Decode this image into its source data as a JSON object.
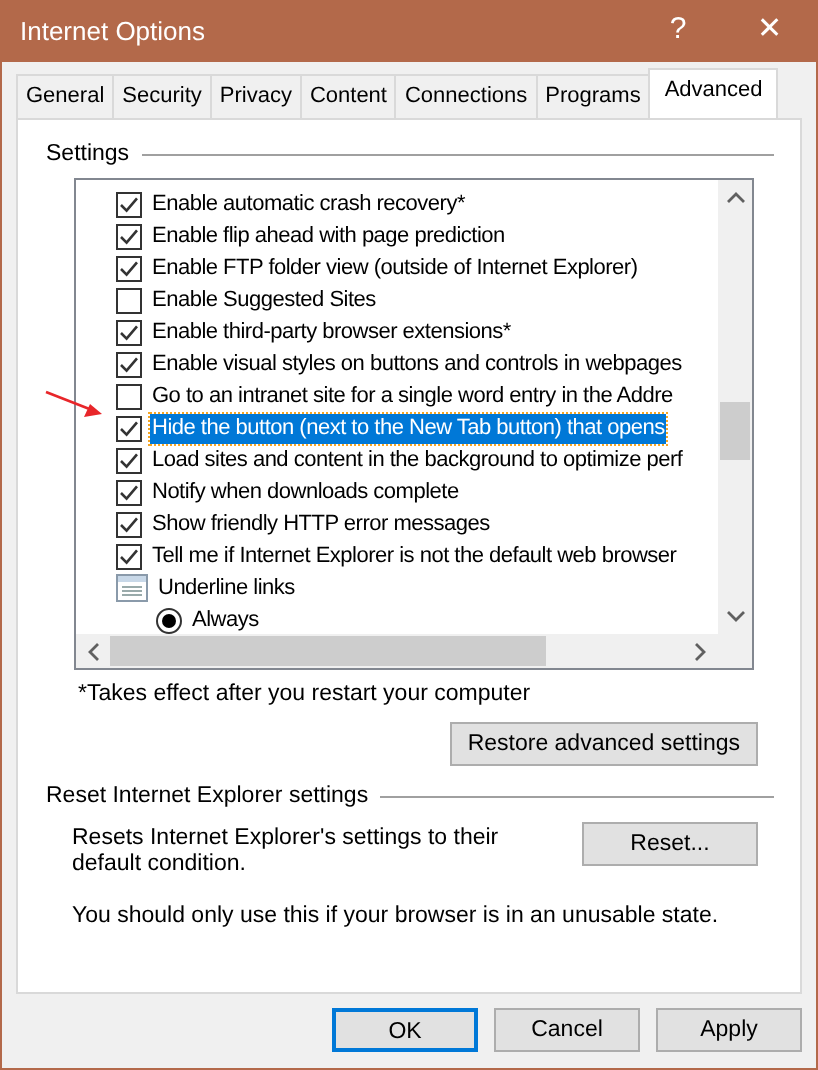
{
  "window": {
    "title": "Internet Options",
    "help": "?",
    "close": "✕"
  },
  "tabs": [
    {
      "label": "General",
      "selected": false
    },
    {
      "label": "Security",
      "selected": false
    },
    {
      "label": "Privacy",
      "selected": false
    },
    {
      "label": "Content",
      "selected": false
    },
    {
      "label": "Connections",
      "selected": false
    },
    {
      "label": "Programs",
      "selected": false
    },
    {
      "label": "Advanced",
      "selected": true
    }
  ],
  "settings": {
    "legend": "Settings",
    "rows": [
      {
        "kind": "checkbox",
        "label": "Enable automatic crash recovery*",
        "checked": true,
        "selected": false
      },
      {
        "kind": "checkbox",
        "label": "Enable flip ahead with page prediction",
        "checked": true,
        "selected": false
      },
      {
        "kind": "checkbox",
        "label": "Enable FTP folder view (outside of Internet Explorer)",
        "checked": true,
        "selected": false
      },
      {
        "kind": "checkbox",
        "label": "Enable Suggested Sites",
        "checked": false,
        "selected": false
      },
      {
        "kind": "checkbox",
        "label": "Enable third-party browser extensions*",
        "checked": true,
        "selected": false
      },
      {
        "kind": "checkbox",
        "label": "Enable visual styles on buttons and controls in webpages",
        "checked": true,
        "selected": false
      },
      {
        "kind": "checkbox",
        "label": "Go to an intranet site for a single word entry in the Addre",
        "checked": false,
        "selected": false
      },
      {
        "kind": "checkbox",
        "label": "Hide the button (next to the New Tab button) that opens",
        "checked": true,
        "selected": true
      },
      {
        "kind": "checkbox",
        "label": "Load sites and content in the background to optimize perf",
        "checked": true,
        "selected": false
      },
      {
        "kind": "checkbox",
        "label": "Notify when downloads complete",
        "checked": true,
        "selected": false
      },
      {
        "kind": "checkbox",
        "label": "Show friendly HTTP error messages",
        "checked": true,
        "selected": false
      },
      {
        "kind": "checkbox",
        "label": "Tell me if Internet Explorer is not the default web browser",
        "checked": true,
        "selected": false
      },
      {
        "kind": "group",
        "label": "Underline links",
        "selected": false
      },
      {
        "kind": "radio",
        "label": "Always",
        "checked": true,
        "selected": false
      }
    ],
    "note": "*Takes effect after you restart your computer",
    "restore_button": "Restore advanced settings"
  },
  "reset": {
    "legend": "Reset Internet Explorer settings",
    "description": "Resets Internet Explorer's settings to their default condition.",
    "button": "Reset...",
    "warning": "You should only use this if your browser is in an unusable state."
  },
  "buttons": [
    {
      "label": "OK",
      "default": true
    },
    {
      "label": "Cancel",
      "default": false
    },
    {
      "label": "Apply",
      "default": false
    }
  ]
}
